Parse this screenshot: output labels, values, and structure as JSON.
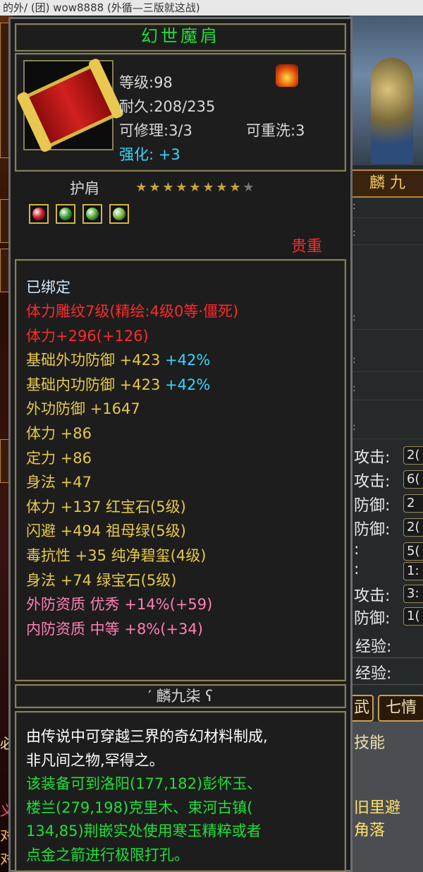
{
  "window": {
    "title": "的外/ (团) wow8888 (外循—三版就这战)"
  },
  "background": {
    "name_plate": "麟 九",
    "stats": [
      {
        "label": "攻击:",
        "value": "2("
      },
      {
        "label": "攻击:",
        "value": "6("
      },
      {
        "label": "防御:",
        "value": "2"
      },
      {
        "label": "防御:",
        "value": "2("
      },
      {
        "label": ":",
        "value": "5("
      },
      {
        "label": ":",
        "value": "1:"
      },
      {
        "label": "攻击:",
        "value": "3:"
      },
      {
        "label": "防御:",
        "value": "1("
      }
    ],
    "exp_rows": [
      "经验:",
      "经验:"
    ],
    "tab_left": "武",
    "tab_right": "七情",
    "left_texts": [
      "必",
      "义",
      "对",
      "对"
    ],
    "right_texts": [
      "技能",
      "旧里避",
      "角落"
    ],
    "dash_rows": [
      ":",
      ":",
      ":",
      ":",
      ":",
      ":"
    ]
  },
  "tooltip": {
    "title": "幻世魔肩",
    "level": "等级:98",
    "durability": "耐久:208/235",
    "repair": "可修理:3/3",
    "rewash": "可重洗:3",
    "enhance_label": "强化:",
    "enhance_value": "+3",
    "slot": "护肩",
    "stars_on": 8,
    "stars_total": 9,
    "gems": [
      {
        "color": "#d81f2b"
      },
      {
        "color": "#3faa3a"
      },
      {
        "color": "#52b53a"
      },
      {
        "color": "#7cc24a"
      }
    ],
    "rarity": "贵重",
    "bound": "已绑定",
    "attributes": [
      [
        {
          "t": "体力雕纹7级(精绘:4级0等·僵死)",
          "c": "#ff2a2a"
        }
      ],
      [
        {
          "t": "体力+296(+126)",
          "c": "#ff2a2a"
        }
      ],
      [
        {
          "t": "基础外功防御 +423 ",
          "c": "#e6c84a"
        },
        {
          "t": "+42%",
          "c": "#35d6ff"
        }
      ],
      [
        {
          "t": "基础内功防御 +423 ",
          "c": "#e6c84a"
        },
        {
          "t": "+42%",
          "c": "#35d6ff"
        }
      ],
      [
        {
          "t": "外功防御 +1647",
          "c": "#e6c84a"
        }
      ],
      [
        {
          "t": "体力 +86",
          "c": "#e6c84a"
        }
      ],
      [
        {
          "t": "定力 +86",
          "c": "#e6c84a"
        }
      ],
      [
        {
          "t": "身法 +47",
          "c": "#e6c84a"
        }
      ],
      [
        {
          "t": "体力 +137 红宝石(5级)",
          "c": "#e6c84a"
        }
      ],
      [
        {
          "t": "闪避 +494 祖母绿(5级)",
          "c": "#e6c84a"
        }
      ],
      [
        {
          "t": "毒抗性 +35 纯净碧玺(4级)",
          "c": "#e6c84a"
        }
      ],
      [
        {
          "t": "身法 +74 绿宝石(5级)",
          "c": "#e6c84a"
        }
      ],
      [
        {
          "t": "外防资质  优秀 +14%(+59)",
          "c": "#ff7fb4"
        }
      ],
      [
        {
          "t": "内防资质  中等 +8%(+34)",
          "c": "#ff7fb4"
        }
      ]
    ],
    "crafter": "′ 麟九柒 ʕ",
    "description": [
      {
        "t": "由传说中可穿越三界的奇幻材料制成,",
        "c": "#ffffff"
      },
      {
        "t": "非凡间之物,罕得之。",
        "c": "#ffffff"
      },
      {
        "t": "该装备可到洛阳(177,182)彭怀玉、",
        "c": "#1fe03a"
      },
      {
        "t": "楼兰(279,198)克里木、束河古镇(",
        "c": "#1fe03a"
      },
      {
        "t": "134,85)荆嵌实处使用寒玉精粹或者",
        "c": "#1fe03a"
      },
      {
        "t": "点金之箭进行极限打孔。",
        "c": "#1fe03a"
      }
    ]
  }
}
